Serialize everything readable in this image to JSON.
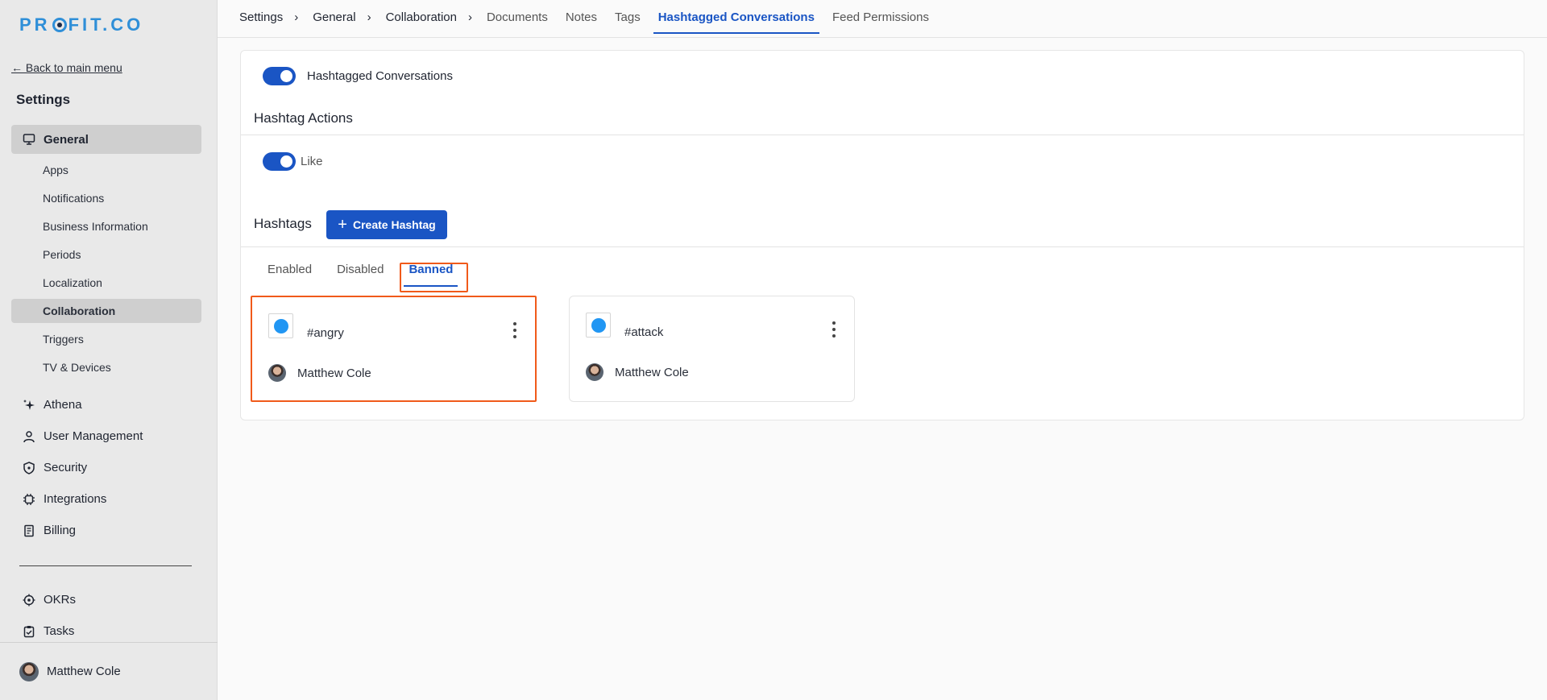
{
  "sidebar": {
    "logo": "PROFIT.CO",
    "back_link": "← Back to main menu",
    "title": "Settings",
    "general": "General",
    "sub_items": [
      "Apps",
      "Notifications",
      "Business Information",
      "Periods",
      "Localization",
      "Collaboration",
      "Triggers",
      "TV & Devices"
    ],
    "main_items": [
      {
        "label": "Athena",
        "icon": "sparkle-icon"
      },
      {
        "label": "User Management",
        "icon": "user-icon"
      },
      {
        "label": "Security",
        "icon": "shield-icon"
      },
      {
        "label": "Integrations",
        "icon": "chip-icon"
      },
      {
        "label": "Billing",
        "icon": "receipt-icon"
      }
    ],
    "lower_items": [
      {
        "label": "OKRs",
        "icon": "target-icon"
      },
      {
        "label": "Tasks",
        "icon": "clipboard-check-icon"
      }
    ],
    "user": "Matthew Cole"
  },
  "topbar": {
    "crumbs": [
      "Settings",
      "General",
      "Collaboration"
    ],
    "tabs": [
      "Documents",
      "Notes",
      "Tags",
      "Hashtagged Conversations",
      "Feed Permissions"
    ],
    "active_tab": "Hashtagged Conversations"
  },
  "main": {
    "feature_toggle": "Hashtagged Conversations",
    "actions_title": "Hashtag Actions",
    "like_toggle": "Like",
    "hashtags_title": "Hashtags",
    "create_button": "Create Hashtag",
    "sub_tabs": [
      "Enabled",
      "Disabled",
      "Banned"
    ],
    "active_sub_tab": "Banned",
    "cards": [
      {
        "name": "#angry",
        "owner": "Matthew Cole",
        "color": "#2196f3"
      },
      {
        "name": "#attack",
        "owner": "Matthew Cole",
        "color": "#2196f3"
      }
    ],
    "accent": "#1a55c4",
    "highlight": "#f05a1a"
  }
}
